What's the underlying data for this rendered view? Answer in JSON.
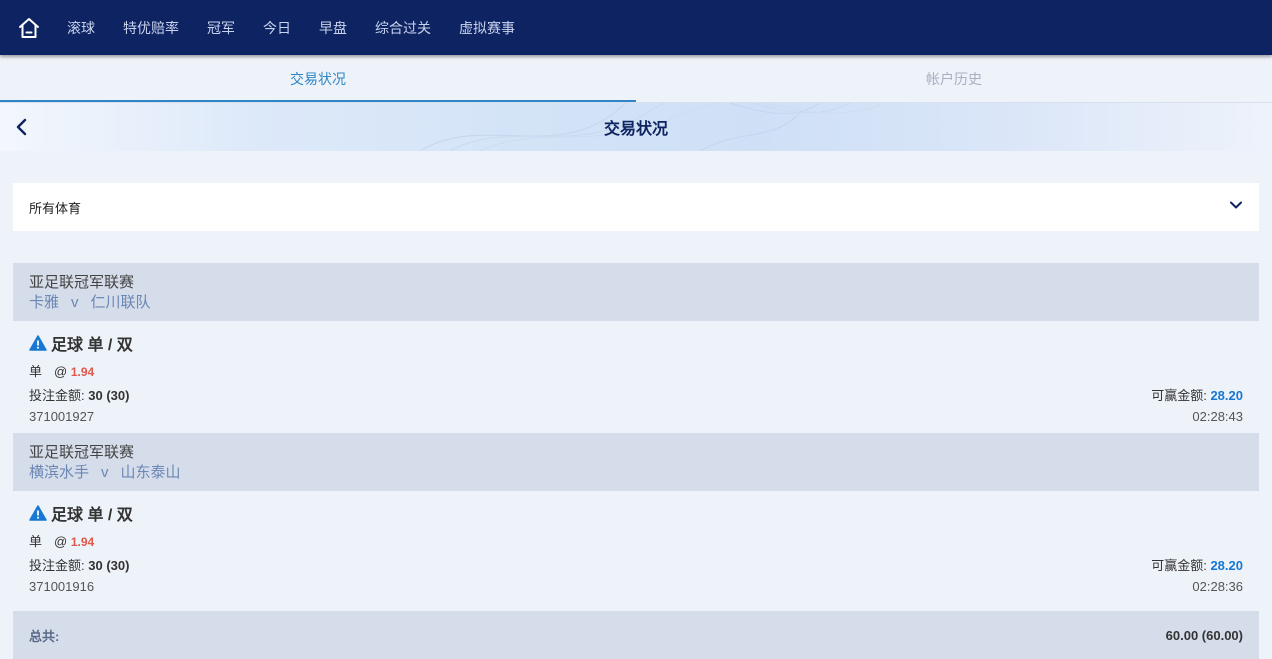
{
  "nav": {
    "items": [
      "滚球",
      "特优赔率",
      "冠军",
      "今日",
      "早盘",
      "综合过关",
      "虚拟赛事"
    ]
  },
  "tabs": [
    {
      "label": "交易状况",
      "active": true
    },
    {
      "label": "帐户历史",
      "active": false
    }
  ],
  "banner": {
    "title": "交易状况"
  },
  "filter": {
    "selected": "所有体育"
  },
  "bets": [
    {
      "league": "亚足联冠军联赛",
      "home": "卡雅",
      "vs": "v",
      "away": "仁川联队",
      "market": "足球 单 / 双",
      "selection": "单",
      "at": "@",
      "odds": "1.94",
      "stake_label": "投注金额:",
      "stake": "30 (30)",
      "ticket": "371001927",
      "win_label": "可赢金额:",
      "win": "28.20",
      "time": "02:28:43"
    },
    {
      "league": "亚足联冠军联赛",
      "home": "横滨水手",
      "vs": "v",
      "away": "山东泰山",
      "market": "足球 单 / 双",
      "selection": "单",
      "at": "@",
      "odds": "1.94",
      "stake_label": "投注金额:",
      "stake": "30 (30)",
      "ticket": "371001916",
      "win_label": "可赢金额:",
      "win": "28.20",
      "time": "02:28:36"
    }
  ],
  "total": {
    "label": "总共:",
    "value": "60.00 (60.00)"
  },
  "colors": {
    "nav_bg": "#0e2362",
    "accent": "#2f86c6",
    "odds": "#e2574c",
    "win": "#1678d2"
  },
  "icons": {
    "home": "home-icon",
    "back": "chevron-left-icon",
    "dropdown": "chevron-down-icon",
    "warning": "warning-icon"
  }
}
